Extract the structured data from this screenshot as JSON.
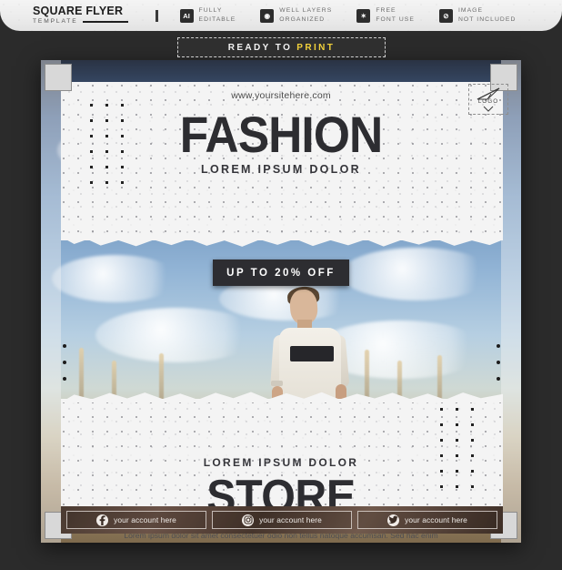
{
  "topbar": {
    "brand_title": "SQUARE FLYER",
    "brand_subtitle": "TEMPLATE",
    "features": [
      {
        "icon": "ai-file-icon",
        "badge": "AI",
        "line1": "FULLY",
        "line2": "EDITABLE"
      },
      {
        "icon": "layers-icon",
        "badge": "◉",
        "line1": "WELL LAYERS",
        "line2": "ORGANIZED"
      },
      {
        "icon": "font-icon",
        "badge": "✶",
        "line1": "FREE",
        "line2": "FONT USE"
      },
      {
        "icon": "no-image-icon",
        "badge": "⊘",
        "line1": "IMAGE",
        "line2": "NOT INCLUDED"
      }
    ]
  },
  "ribbon": {
    "text_white": "READY TO",
    "text_yellow": "PRINT"
  },
  "flyer": {
    "site_url": "www.yoursitehere.com",
    "logo_word": "LOGO",
    "headline": "FASHION",
    "subline": "LOREM IPSUM DOLOR",
    "promo": "UP TO 20% OFF",
    "store_sub": "LOREM IPSUM DOLOR",
    "store_title": "STORE",
    "body_copy": "Lorem ipsum dolor sit amet consectetuer odio non tellus natoque accumsan. Sed hac enim Lorem tempus tortor justo eget scelerisque",
    "social": [
      {
        "icon": "facebook-icon",
        "glyph": "f",
        "label": "your account here"
      },
      {
        "icon": "instagram-icon",
        "glyph": "▣",
        "label": "your account here"
      },
      {
        "icon": "twitter-icon",
        "glyph": "✐",
        "label": "your account here"
      }
    ]
  },
  "colors": {
    "ink": "#2d2d31",
    "accent_yellow": "#f2d13b",
    "paper": "#f4f4f4",
    "social_bar": "#4a3a31"
  }
}
